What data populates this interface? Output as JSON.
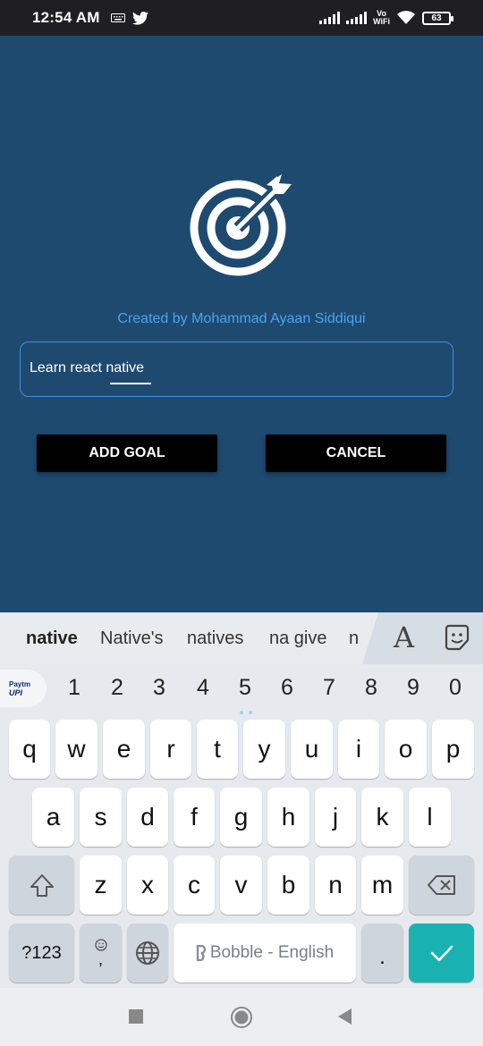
{
  "status_bar": {
    "time": "12:54 AM",
    "network_label": "Vo\nWiFi",
    "battery": "63"
  },
  "app": {
    "credit": "Created by Mohammad Ayaan Siddiqui",
    "goal_input_value": "Learn react native",
    "add_button": "ADD GOAL",
    "cancel_button": "CANCEL",
    "accent_color": "#4aa3f0",
    "background_color": "#1f4a70"
  },
  "keyboard": {
    "suggestions": [
      "native",
      "Native's",
      "natives",
      "na give",
      "n"
    ],
    "paytm_top": "Paytm",
    "paytm_bottom": "UPI",
    "numbers": [
      "1",
      "2",
      "3",
      "4",
      "5",
      "6",
      "7",
      "8",
      "9",
      "0"
    ],
    "row1": [
      "q",
      "w",
      "e",
      "r",
      "t",
      "y",
      "u",
      "i",
      "o",
      "p"
    ],
    "row2": [
      "a",
      "s",
      "d",
      "f",
      "g",
      "h",
      "j",
      "k",
      "l"
    ],
    "row3": [
      "z",
      "x",
      "c",
      "v",
      "b",
      "n",
      "m"
    ],
    "symbols_key": "?123",
    "comma_key": ",",
    "space_label": "Bobble - English",
    "period_key": ".",
    "enter_color": "#19b2b0"
  }
}
